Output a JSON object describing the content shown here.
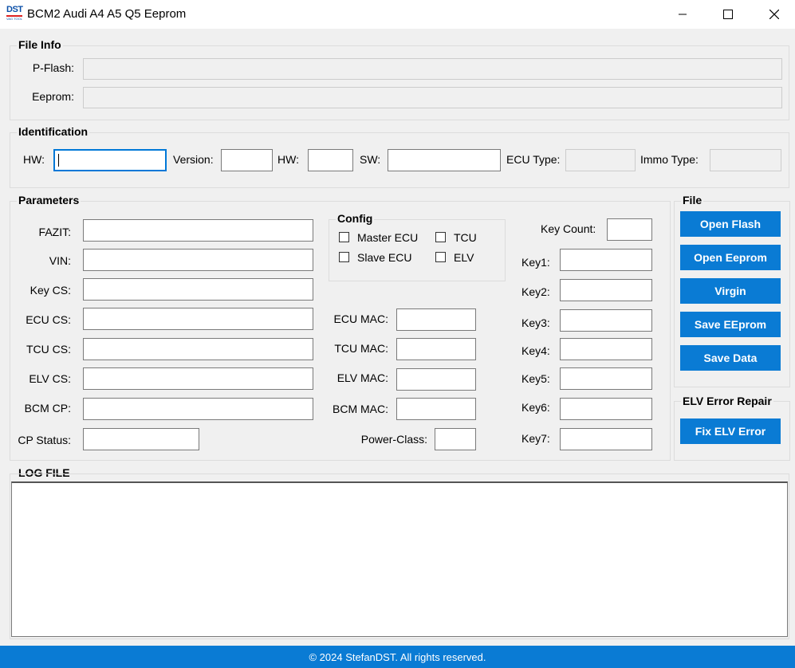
{
  "window": {
    "title": "BCM2 Audi A4 A5 Q5 Eeprom",
    "icon_top": "DST",
    "icon_bottom": "VAG TOOL"
  },
  "file_info": {
    "group_label": "File Info",
    "pflash_label": "P-Flash:",
    "pflash_value": "",
    "eeprom_label": "Eeprom:",
    "eeprom_value": ""
  },
  "identification": {
    "group_label": "Identification",
    "hw_label": "HW:",
    "version_label": "Version:",
    "hw2_label": "HW:",
    "sw_label": "SW:",
    "ecu_type_label": "ECU Type:",
    "immo_type_label": "Immo Type:",
    "hw_value": "",
    "version_value": "",
    "hw2_value": "",
    "sw_value": "",
    "ecu_type_value": "",
    "immo_type_value": ""
  },
  "parameters": {
    "group_label": "Parameters",
    "fazit_label": "FAZIT:",
    "vin_label": "VIN:",
    "key_cs_label": "Key CS:",
    "ecu_cs_label": "ECU CS:",
    "tcu_cs_label": "TCU CS:",
    "elv_cs_label": "ELV CS:",
    "bcm_cp_label": "BCM CP:",
    "cp_status_label": "CP Status:",
    "ecu_mac_label": "ECU MAC:",
    "tcu_mac_label": "TCU MAC:",
    "elv_mac_label": "ELV MAC:",
    "bcm_mac_label": "BCM MAC:",
    "power_class_label": "Power-Class:",
    "key_count_label": "Key Count:",
    "keys": [
      "Key1:",
      "Key2:",
      "Key3:",
      "Key4:",
      "Key5:",
      "Key6:",
      "Key7:"
    ]
  },
  "config": {
    "group_label": "Config",
    "master_ecu_label": "Master ECU",
    "tcu_label": "TCU",
    "slave_ecu_label": "Slave ECU",
    "elv_label": "ELV"
  },
  "file_panel": {
    "group_label": "File",
    "open_flash": "Open Flash",
    "open_eeprom": "Open Eeprom",
    "virgin": "Virgin",
    "save_eeprom": "Save EEprom",
    "save_data": "Save Data"
  },
  "elv_repair": {
    "group_label": "ELV Error Repair",
    "fix_elv": "Fix ELV Error"
  },
  "log": {
    "label": "LOG FILE"
  },
  "footer": {
    "text": "© 2024 StefanDST. All rights reserved."
  },
  "colors": {
    "accent": "#0a7bd4",
    "background": "#f0f0f0"
  }
}
